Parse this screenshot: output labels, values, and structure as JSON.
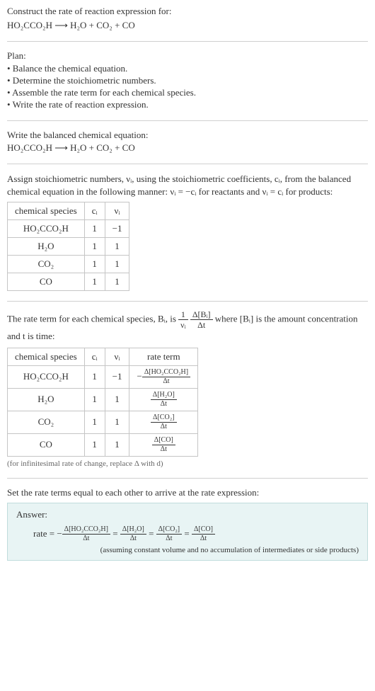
{
  "question": {
    "prompt": "Construct the rate of reaction expression for:",
    "equation": "HO₂CCO₂H  ⟶  H₂O + CO₂ + CO"
  },
  "plan": {
    "heading": "Plan:",
    "items": [
      "• Balance the chemical equation.",
      "• Determine the stoichiometric numbers.",
      "• Assemble the rate term for each chemical species.",
      "• Write the rate of reaction expression."
    ]
  },
  "balanced": {
    "heading": "Write the balanced chemical equation:",
    "equation": "HO₂CCO₂H  ⟶  H₂O + CO₂ + CO"
  },
  "stoich": {
    "text_before": "Assign stoichiometric numbers, νᵢ, using the stoichiometric coefficients, cᵢ, from the balanced chemical equation in the following manner: νᵢ = −cᵢ for reactants and νᵢ = cᵢ for products:",
    "headers": [
      "chemical species",
      "cᵢ",
      "νᵢ"
    ],
    "rows": [
      {
        "species": "HO₂CCO₂H",
        "c": "1",
        "nu": "−1"
      },
      {
        "species": "H₂O",
        "c": "1",
        "nu": "1"
      },
      {
        "species": "CO₂",
        "c": "1",
        "nu": "1"
      },
      {
        "species": "CO",
        "c": "1",
        "nu": "1"
      }
    ]
  },
  "rateterm": {
    "text_part1": "The rate term for each chemical species, Bᵢ, is ",
    "text_part2": " where [Bᵢ] is the amount concentration and t is time:",
    "frac1_num": "1",
    "frac1_den": "νᵢ",
    "frac2_num": "Δ[Bᵢ]",
    "frac2_den": "Δt",
    "headers": [
      "chemical species",
      "cᵢ",
      "νᵢ",
      "rate term"
    ],
    "rows": [
      {
        "species": "HO₂CCO₂H",
        "c": "1",
        "nu": "−1",
        "rate_prefix": "−",
        "rate_num": "Δ[HO₂CCO₂H]",
        "rate_den": "Δt"
      },
      {
        "species": "H₂O",
        "c": "1",
        "nu": "1",
        "rate_prefix": "",
        "rate_num": "Δ[H₂O]",
        "rate_den": "Δt"
      },
      {
        "species": "CO₂",
        "c": "1",
        "nu": "1",
        "rate_prefix": "",
        "rate_num": "Δ[CO₂]",
        "rate_den": "Δt"
      },
      {
        "species": "CO",
        "c": "1",
        "nu": "1",
        "rate_prefix": "",
        "rate_num": "Δ[CO]",
        "rate_den": "Δt"
      }
    ],
    "note": "(for infinitesimal rate of change, replace Δ with d)"
  },
  "final": {
    "heading": "Set the rate terms equal to each other to arrive at the rate expression:"
  },
  "answer": {
    "heading": "Answer:",
    "prefix": "rate = −",
    "terms": [
      {
        "num": "Δ[HO₂CCO₂H]",
        "den": "Δt"
      },
      {
        "num": "Δ[H₂O]",
        "den": "Δt"
      },
      {
        "num": "Δ[CO₂]",
        "den": "Δt"
      },
      {
        "num": "Δ[CO]",
        "den": "Δt"
      }
    ],
    "eq": " = ",
    "note": "(assuming constant volume and no accumulation of intermediates or side products)"
  },
  "chart_data": {
    "type": "table",
    "tables": [
      {
        "title": "Stoichiometric numbers",
        "headers": [
          "chemical species",
          "c_i",
          "nu_i"
        ],
        "rows": [
          [
            "HO2CCO2H",
            1,
            -1
          ],
          [
            "H2O",
            1,
            1
          ],
          [
            "CO2",
            1,
            1
          ],
          [
            "CO",
            1,
            1
          ]
        ]
      },
      {
        "title": "Rate terms",
        "headers": [
          "chemical species",
          "c_i",
          "nu_i",
          "rate term"
        ],
        "rows": [
          [
            "HO2CCO2H",
            1,
            -1,
            "-Δ[HO2CCO2H]/Δt"
          ],
          [
            "H2O",
            1,
            1,
            "Δ[H2O]/Δt"
          ],
          [
            "CO2",
            1,
            1,
            "Δ[CO2]/Δt"
          ],
          [
            "CO",
            1,
            1,
            "Δ[CO]/Δt"
          ]
        ]
      }
    ]
  }
}
